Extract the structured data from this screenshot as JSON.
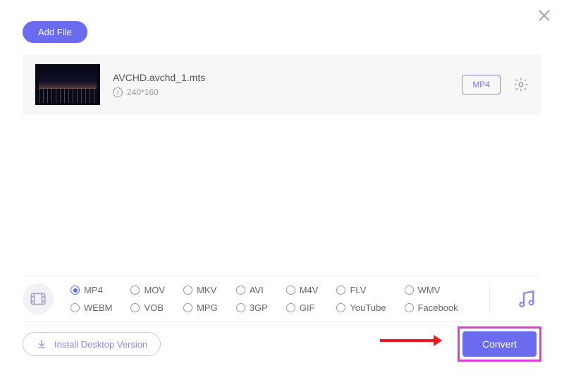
{
  "toolbar": {
    "add_file_label": "Add File"
  },
  "file": {
    "name": "AVCHD.avchd_1.mts",
    "resolution": "240*160",
    "output_format_label": "MP4"
  },
  "formats": [
    {
      "label": "MP4",
      "selected": true
    },
    {
      "label": "MOV",
      "selected": false
    },
    {
      "label": "MKV",
      "selected": false
    },
    {
      "label": "AVI",
      "selected": false
    },
    {
      "label": "M4V",
      "selected": false
    },
    {
      "label": "FLV",
      "selected": false
    },
    {
      "label": "WMV",
      "selected": false
    },
    {
      "label": "WEBM",
      "selected": false
    },
    {
      "label": "VOB",
      "selected": false
    },
    {
      "label": "MPG",
      "selected": false
    },
    {
      "label": "3GP",
      "selected": false
    },
    {
      "label": "GIF",
      "selected": false
    },
    {
      "label": "YouTube",
      "selected": false
    },
    {
      "label": "Facebook",
      "selected": false
    }
  ],
  "footer": {
    "install_label": "Install Desktop Version",
    "convert_label": "Convert"
  }
}
